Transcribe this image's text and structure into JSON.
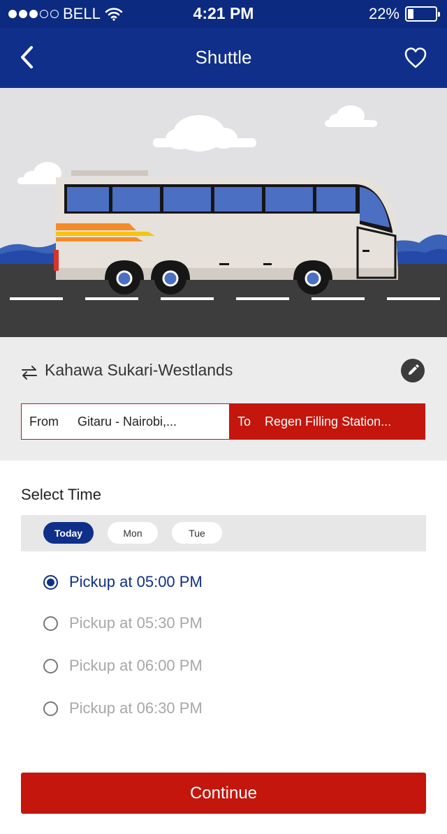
{
  "status": {
    "carrier": "BELL",
    "time": "4:21 PM",
    "battery": "22%"
  },
  "nav": {
    "title": "Shuttle",
    "back_icon": "chevron-left-icon",
    "fav_icon": "heart-icon"
  },
  "route": {
    "name": "Kahawa Sukari-Westlands",
    "from_label": "From",
    "from_value": "Gitaru - Nairobi,...",
    "to_label": "To",
    "to_value": "Regen Filling Station..."
  },
  "schedule": {
    "heading": "Select Time",
    "days": [
      "Today",
      "Mon",
      "Tue"
    ],
    "selected_day": "Today",
    "slots": [
      "Pickup at 05:00 PM",
      "Pickup at 05:30 PM",
      "Pickup at 06:00 PM",
      "Pickup at 06:30 PM"
    ],
    "selected_slot": "Pickup at 05:00 PM"
  },
  "actions": {
    "continue_label": "Continue"
  },
  "colors": {
    "primary": "#0f2f8a",
    "accent": "#c4160c"
  }
}
